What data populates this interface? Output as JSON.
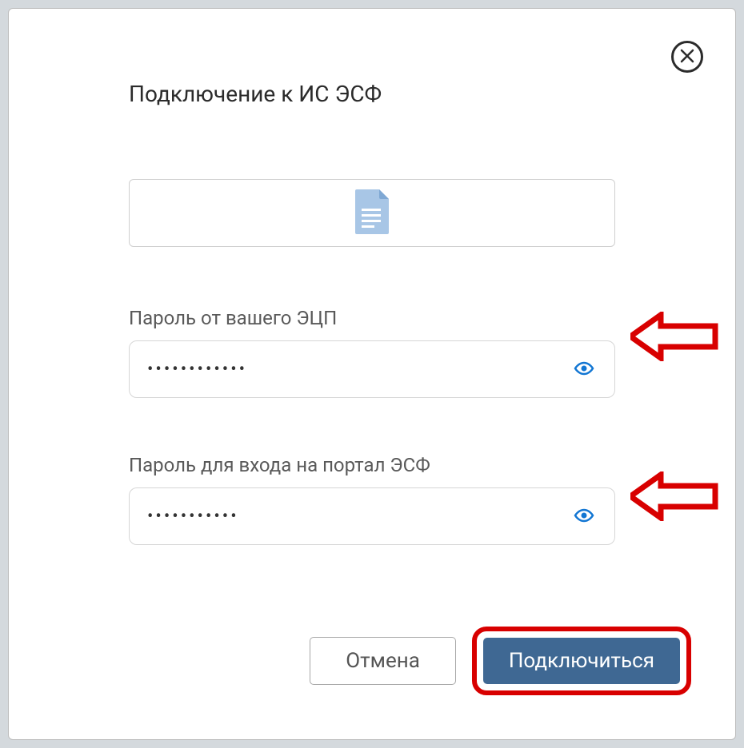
{
  "dialog": {
    "title": "Подключение к ИС ЭСФ"
  },
  "fields": {
    "ecp_password": {
      "label": "Пароль от вашего ЭЦП",
      "value": "••••••••••••"
    },
    "portal_password": {
      "label": "Пароль для входа на портал ЭСФ",
      "value": "•••••••••••"
    }
  },
  "buttons": {
    "cancel": "Отмена",
    "connect": "Подключиться"
  },
  "icons": {
    "close": "close-icon",
    "file": "file-icon",
    "eye": "eye-icon"
  },
  "colors": {
    "primary_button": "#3f6893",
    "highlight_red": "#d80000",
    "accent_blue": "#1276d3"
  }
}
